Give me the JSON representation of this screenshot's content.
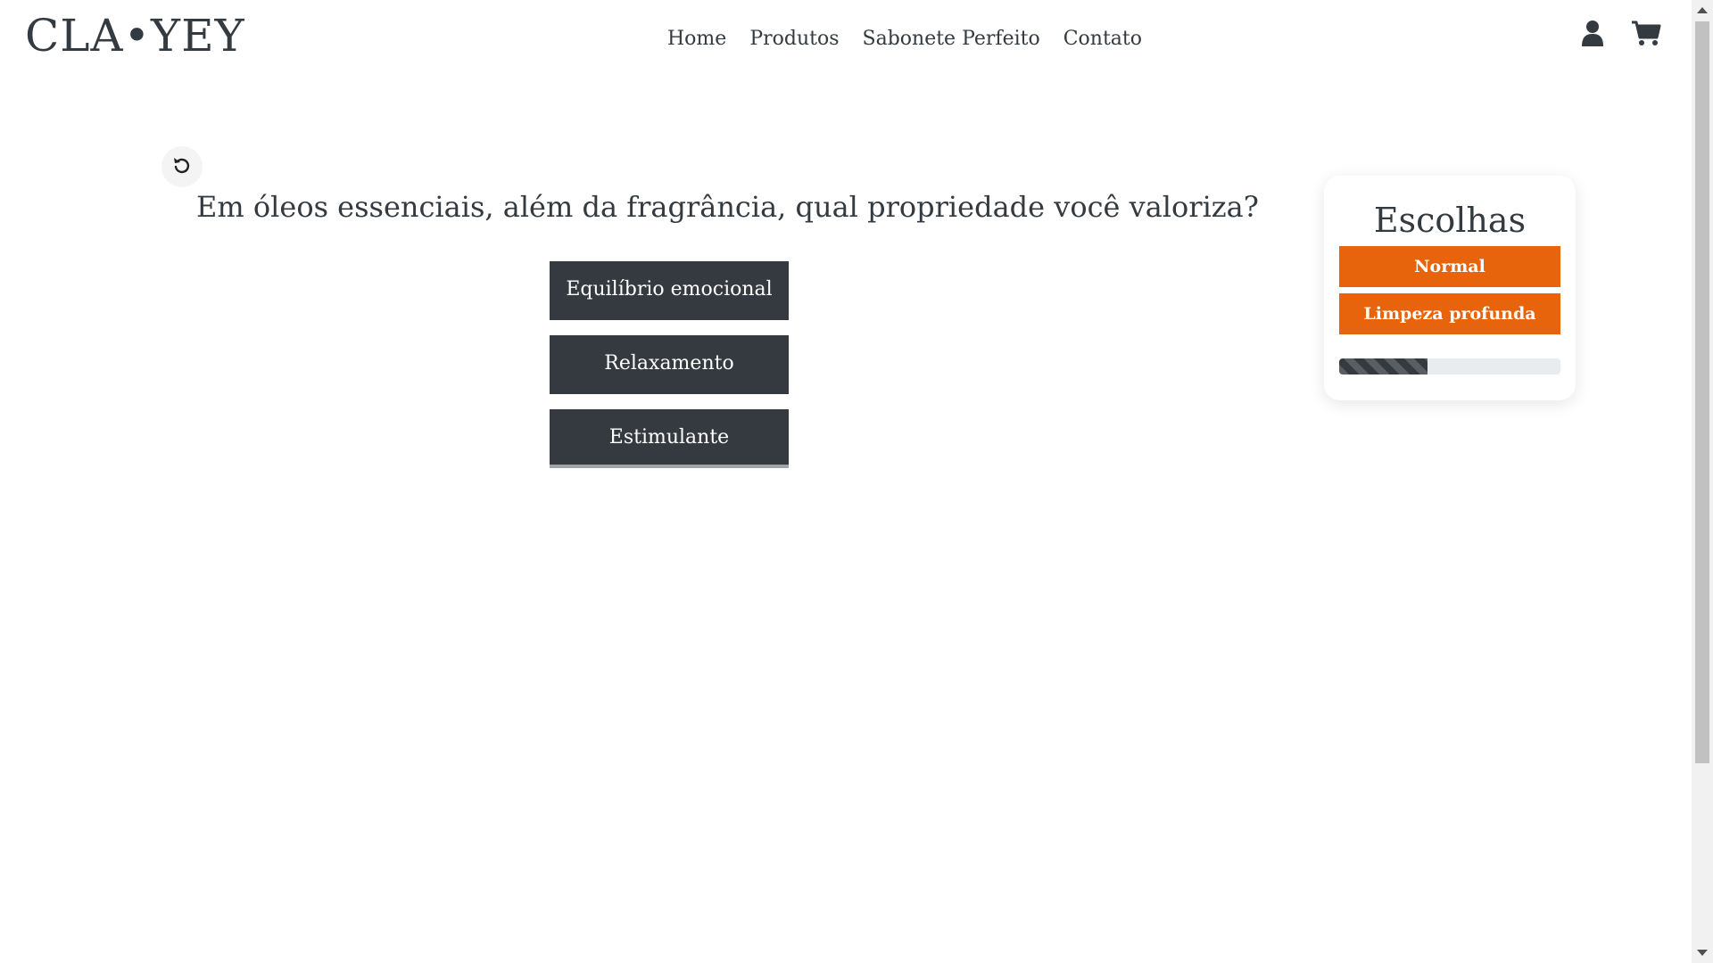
{
  "header": {
    "logo": "CLA•YEY",
    "nav": [
      "Home",
      "Produtos",
      "Sabonete Perfeito",
      "Contato"
    ],
    "icons": [
      "user-icon",
      "cart-icon"
    ]
  },
  "quiz": {
    "undo_icon": "undo-icon",
    "question": "Em óleos essenciais, além da fragrância, qual propriedade você valoriza?",
    "options": [
      "Equilíbrio emocional",
      "Relaxamento",
      "Estimulante"
    ]
  },
  "choices": {
    "title": "Escolhas",
    "items": [
      "Normal",
      "Limpeza profunda"
    ],
    "progress_fraction": 0.4,
    "accent": "#e8640c",
    "dark": "#343a40"
  }
}
